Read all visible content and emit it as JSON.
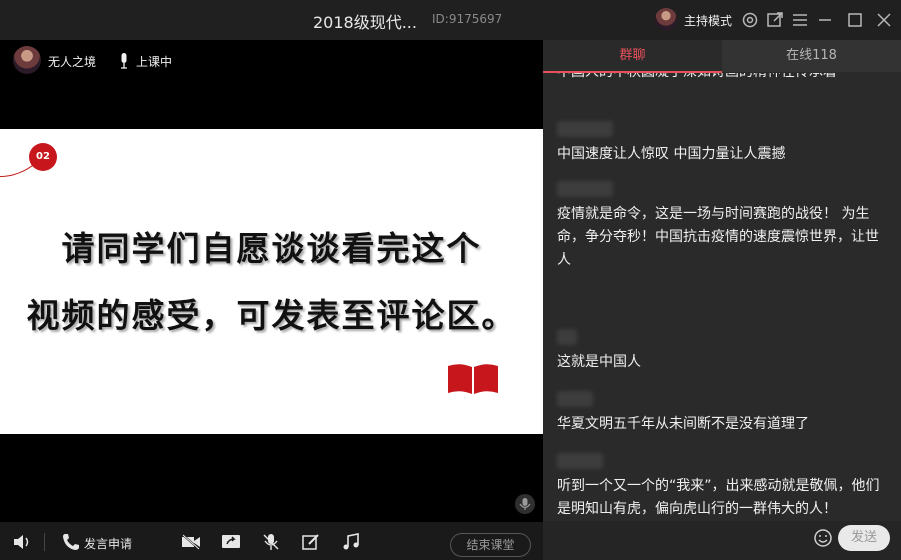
{
  "window": {
    "title": "2018级现代...",
    "room_id": "ID:9175697",
    "host_mode_label": "主持模式"
  },
  "presenter": {
    "name": "无人之境",
    "status": "上课中"
  },
  "slide": {
    "badge": "02",
    "line1": "请同学们自愿谈谈看完这个",
    "line2": "视频的感受，可发表至评论区。"
  },
  "toolbar": {
    "speak_request_label": "发言申请",
    "end_class_label": "结束课堂"
  },
  "chat": {
    "tabs": [
      {
        "label": "群聊",
        "active": true
      },
      {
        "label": "在线118",
        "active": false
      }
    ],
    "messages": [
      {
        "text": "中国人的中秋圆凝了深如诗画的精神在传承着"
      },
      {
        "text": "中国速度让人惊叹 中国力量让人震撼"
      },
      {
        "text": "疫情就是命令，这是一场与时间赛跑的战役！ 为生命，争分夺秒！中国抗击疫情的速度震惊世界，让世人"
      },
      {
        "text": "这就是中国人"
      },
      {
        "text": "华夏文明五千年从未间断不是没有道理了"
      },
      {
        "text": "听到一个又一个的“我来”，出来感动就是敬佩，他们是明知山有虎，偏向虎山行的一群伟大的人！"
      }
    ],
    "send_label": "发送",
    "input_value": ""
  },
  "icons": {
    "topbar": [
      "settings-icon",
      "popout-icon",
      "menu-icon",
      "minimize-icon",
      "maximize-icon",
      "close-icon"
    ],
    "toolbar": [
      "volume-icon",
      "phone-icon",
      "camera-off-icon",
      "screen-share-icon",
      "mic-off-icon",
      "edit-icon",
      "music-icon"
    ]
  },
  "colors": {
    "accent": "#e8505b",
    "slide_red": "#c8161d",
    "panel_bg": "#2a2a2a"
  }
}
